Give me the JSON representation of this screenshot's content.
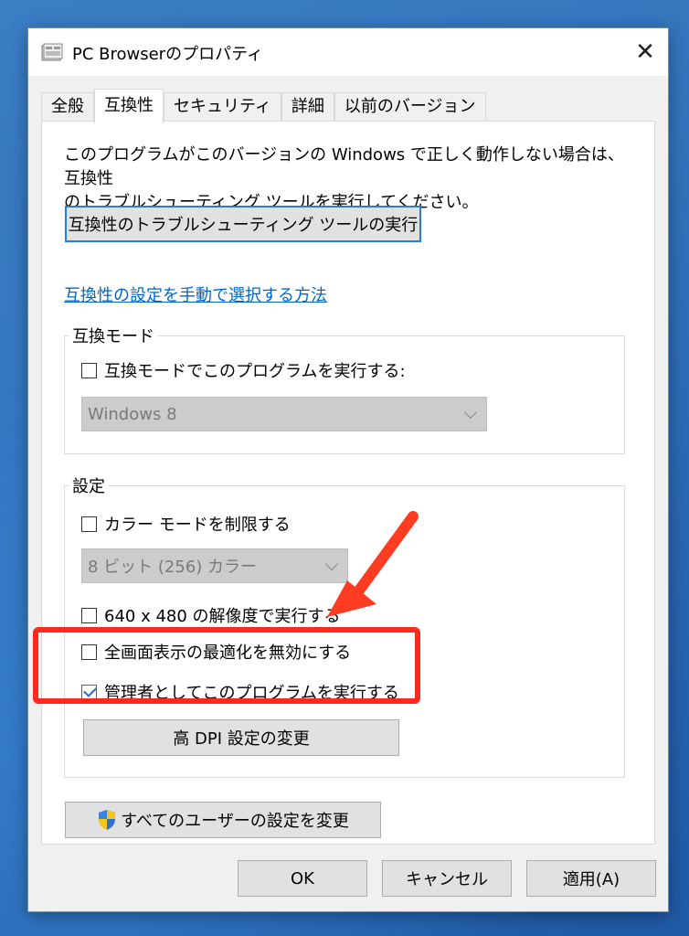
{
  "dialog": {
    "title": "PC Browserのプロパティ",
    "close_glyph": "✕"
  },
  "tabs": [
    {
      "label": "全般",
      "active": false
    },
    {
      "label": "互換性",
      "active": true
    },
    {
      "label": "セキュリティ",
      "active": false
    },
    {
      "label": "詳細",
      "active": false
    },
    {
      "label": "以前のバージョン",
      "active": false
    }
  ],
  "compat": {
    "description_line1": "このプログラムがこのバージョンの Windows で正しく動作しない場合は、互換性",
    "description_line2": "のトラブルシューティング ツールを実行してください。",
    "troubleshooter_button": "互換性のトラブルシューティング ツールの実行",
    "manual_link": "互換性の設定を手動で選択する方法"
  },
  "compat_mode": {
    "legend": "互換モード",
    "checkbox_label": "互換モードでこのプログラムを実行する:",
    "checked": false,
    "select_value": "Windows 8"
  },
  "settings": {
    "legend": "設定",
    "reduced_color": {
      "label": "カラー モードを制限する",
      "checked": false
    },
    "color_select_value": "8 ビット (256) カラー",
    "resolution_640": {
      "label": "640 x 480 の解像度で実行する",
      "checked": false
    },
    "disable_fullscreen": {
      "label": "全画面表示の最適化を無効にする",
      "checked": false
    },
    "run_as_admin": {
      "label": "管理者としてこのプログラムを実行する",
      "checked": true
    },
    "dpi_button": "高 DPI 設定の変更"
  },
  "all_users_button": "すべてのユーザーの設定を変更",
  "footer": {
    "ok": "OK",
    "cancel": "キャンセル",
    "apply": "適用(A)"
  },
  "icons": {
    "title": "program-icon",
    "shield": "uac-shield-icon"
  },
  "colors": {
    "highlight": "#ff2a1f",
    "link": "#0066cc",
    "focus": "#2b7bd3"
  }
}
